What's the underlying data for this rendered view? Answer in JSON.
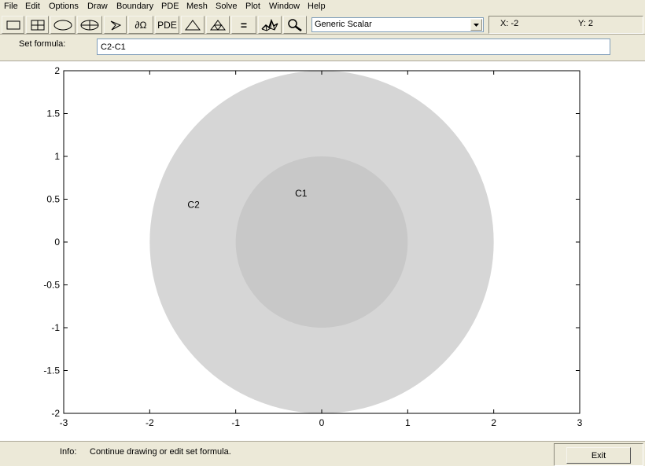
{
  "menu": [
    "File",
    "Edit",
    "Options",
    "Draw",
    "Boundary",
    "PDE",
    "Mesh",
    "Solve",
    "Plot",
    "Window",
    "Help"
  ],
  "toolbar": {
    "buttons": [
      {
        "name": "rectangle-tool-button",
        "icon": "rectangle-icon"
      },
      {
        "name": "centered-rectangle-tool-button",
        "icon": "centered-rectangle-icon"
      },
      {
        "name": "ellipse-tool-button",
        "icon": "ellipse-icon"
      },
      {
        "name": "centered-ellipse-tool-button",
        "icon": "centered-ellipse-icon"
      },
      {
        "name": "polygon-tool-button",
        "icon": "polygon-icon"
      },
      {
        "name": "boundary-mode-button",
        "icon": "boundary-icon",
        "text": "∂Ω"
      },
      {
        "name": "pde-spec-button",
        "icon": "pde-text-icon",
        "text": "PDE"
      },
      {
        "name": "init-mesh-button",
        "icon": "triangle-icon"
      },
      {
        "name": "refine-mesh-button",
        "icon": "refined-triangle-icon"
      },
      {
        "name": "solve-button",
        "icon": "equals-icon",
        "text": "="
      },
      {
        "name": "plot-solution-button",
        "icon": "surface-plot-icon"
      },
      {
        "name": "zoom-button",
        "icon": "magnifier-icon"
      }
    ],
    "app_mode": "Generic Scalar",
    "coord_x": "X:  -2",
    "coord_y": "Y:  2"
  },
  "formula": {
    "label": "Set formula:",
    "value": "C2-C1"
  },
  "plot": {
    "xlim": [
      -3,
      3
    ],
    "ylim": [
      -2,
      2
    ],
    "xticks": [
      "-3",
      "-2",
      "-1",
      "0",
      "1",
      "2",
      "3"
    ],
    "yticks": [
      "2",
      "1.5",
      "1",
      "0.5",
      "0",
      "-0.5",
      "-1",
      "-1.5",
      "-2"
    ],
    "shapes": [
      {
        "label": "C2",
        "cx": 0,
        "cy": 0,
        "r": 2,
        "color": "#d6d6d6",
        "label_x": -1.49,
        "label_y": 0.43
      },
      {
        "label": "C1",
        "cx": 0,
        "cy": 0,
        "r": 1,
        "color": "#c8c8c8",
        "label_x": -0.24,
        "label_y": 0.56
      }
    ]
  },
  "status": {
    "info_label": "Info:",
    "info_text": "Continue drawing or edit set formula.",
    "exit_label": "Exit"
  },
  "colors": {
    "chrome": "#ece9d8",
    "outer_circle": "#d6d6d6",
    "inner_circle": "#c8c8c8"
  }
}
